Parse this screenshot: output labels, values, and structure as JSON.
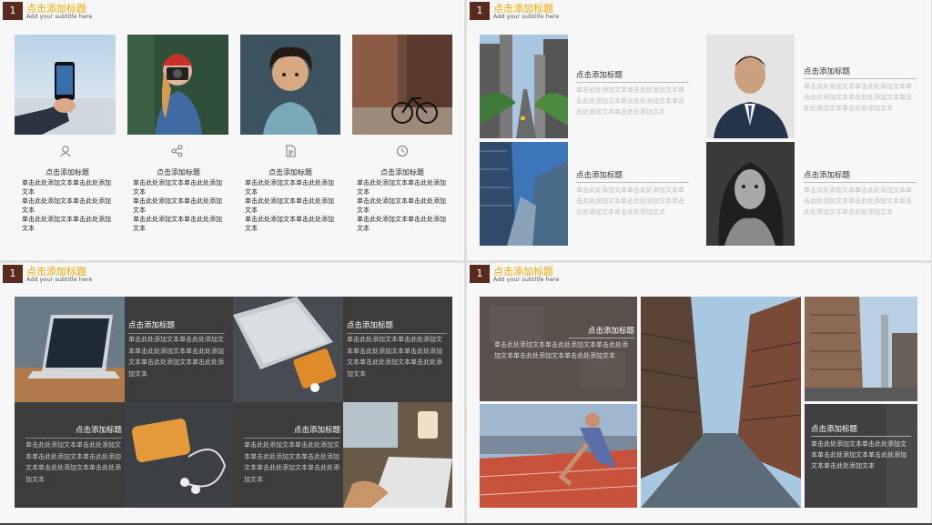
{
  "header": {
    "number": "1",
    "title": "点击添加标题",
    "subtitle": "Add your subtitle here"
  },
  "slide1": {
    "columns": [
      {
        "icon": "user-icon",
        "title": "点击添加标题",
        "lines": [
          "单击此处添加文本单击此处添加文本",
          "单击此处添加文本单击此处添加文本",
          "单击此处添加文本单击此处添加文本"
        ]
      },
      {
        "icon": "share-icon",
        "title": "点击添加标题",
        "lines": [
          "单击此处添加文本单击此处添加文本",
          "单击此处添加文本单击此处添加文本",
          "单击此处添加文本单击此处添加文本"
        ]
      },
      {
        "icon": "document-icon",
        "title": "点击添加标题",
        "lines": [
          "单击此处添加文本单击此处添加文本",
          "单击此处添加文本单击此处添加文本",
          "单击此处添加文本单击此处添加文本"
        ]
      },
      {
        "icon": "clock-icon",
        "title": "点击添加标题",
        "lines": [
          "单击此处添加文本单击此处添加文本",
          "单击此处添加文本单击此处添加文本",
          "单击此处添加文本单击此处添加文本"
        ]
      }
    ]
  },
  "slide2": {
    "blocks": [
      {
        "title": "点击添加标题",
        "body": "单击此处添加文本单击此处添加文本单击此处添加文本单击此处添加文本单击此处添加文本单击此处添加文本"
      },
      {
        "title": "点击添加标题",
        "body": "单击此处添加文本单击此处添加文本单击此处添加文本单击此处添加文本单击此处添加文本单击此处添加文本"
      },
      {
        "title": "点击添加标题",
        "body": "单击此处添加文本单击此处添加文本单击此处添加文本单击此处添加文本单击此处添加文本单击此处添加文本"
      },
      {
        "title": "点击添加标题",
        "body": "单击此处添加文本单击此处添加文本单击此处添加文本单击此处添加文本单击此处添加文本单击此处添加文本"
      }
    ]
  },
  "slide3": {
    "blocks": [
      {
        "title": "点击添加标题",
        "body": "单击此处添加文本单击此处添加文本单击此处添加文本单击此处添加文本单击此处添加文本单击此处添加文本"
      },
      {
        "title": "点击添加标题",
        "body": "单击此处添加文本单击此处添加文本单击此处添加文本单击此处添加文本单击此处添加文本单击此处添加文本"
      },
      {
        "title": "点击添加标题",
        "body": "单击此处添加文本单击此处添加文本单击此处添加文本单击此处添加文本单击此处添加文本单击此处添加文本"
      },
      {
        "title": "点击添加标题",
        "body": "单击此处添加文本单击此处添加文本单击此处添加文本单击此处添加文本单击此处添加文本单击此处添加文本"
      }
    ]
  },
  "slide4": {
    "blocks": [
      {
        "title": "点击添加标题",
        "body": "单击此处添加文本单击此处添加文本单击此处添加文本单击此处添加文本单击此处添加文本"
      },
      {
        "title": "点击添加标题",
        "body": "单击此处添加文本单击此处添加文本单击此处添加文本单击此处添加文本单击此处添加文本"
      }
    ]
  },
  "colors": {
    "accent": "#f2a900",
    "badge": "#5b2a1e",
    "dark_panel": "#3c3c3c"
  }
}
